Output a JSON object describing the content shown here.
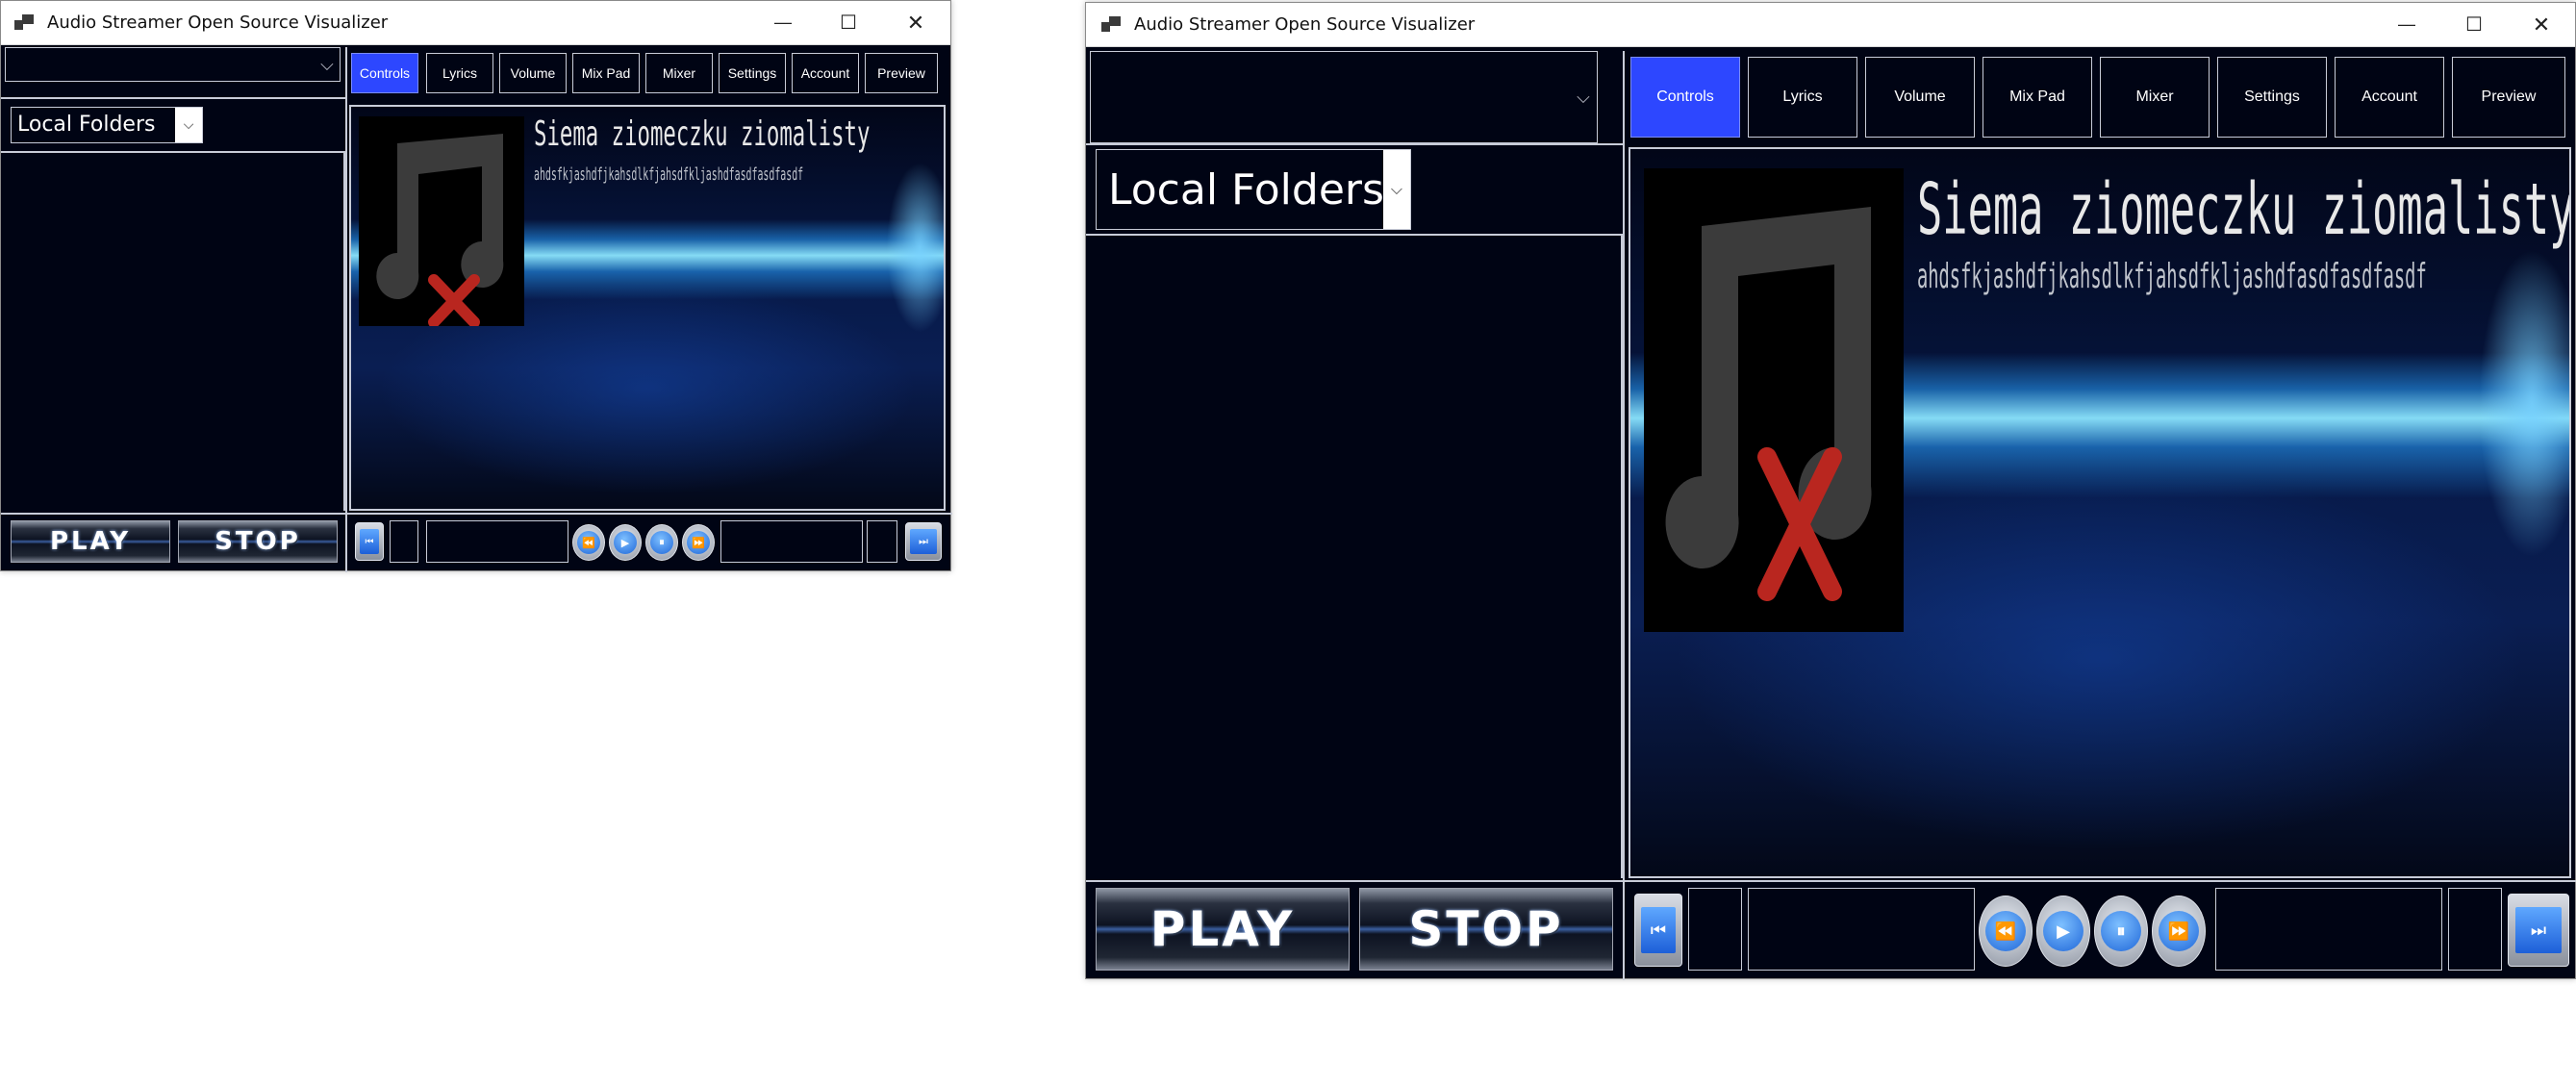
{
  "window": {
    "title": "Audio Streamer Open Source Visualizer",
    "controls": {
      "minimize": "—",
      "maximize": "☐",
      "close": "✕"
    }
  },
  "source_select": {
    "value": "",
    "arrow": "⌵"
  },
  "folder_select": {
    "value": "Local Folders",
    "arrow": "⌵"
  },
  "tabs": [
    {
      "label": "Controls",
      "active": true
    },
    {
      "label": "Lyrics",
      "active": false
    },
    {
      "label": "Volume",
      "active": false
    },
    {
      "label": "Mix Pad",
      "active": false
    },
    {
      "label": "Mixer",
      "active": false
    },
    {
      "label": "Settings",
      "active": false
    },
    {
      "label": "Account",
      "active": false
    },
    {
      "label": "Preview",
      "active": false
    }
  ],
  "now_playing": {
    "title": "Siema ziomeczku ziomalisty",
    "subtitle": "ahdsfkjashdfjkahsdlkfjahsdfkljashdfasdfasdfasdf",
    "album_art": "missing-music-icon"
  },
  "playback": {
    "play_label": "PLAY",
    "stop_label": "STOP",
    "icons": {
      "skip_back": "skip-back-icon",
      "rewind": "rewind-icon",
      "play": "play-icon",
      "pause": "pause-icon",
      "fast_forward": "fast-forward-icon",
      "skip_forward": "skip-forward-icon"
    }
  },
  "colors": {
    "background": "#000414",
    "active_tab": "#2d47ff",
    "border": "#c8ccd8",
    "album_x": "#b9261f"
  }
}
